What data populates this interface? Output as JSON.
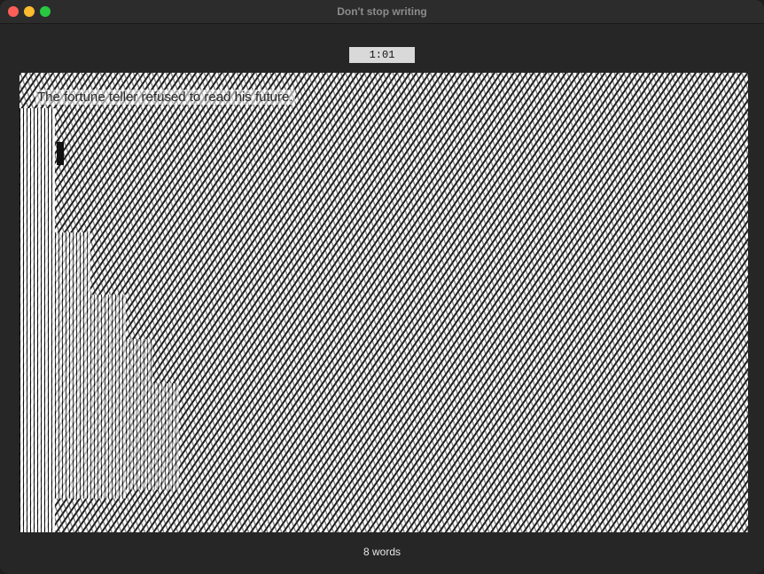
{
  "window": {
    "title": "Don't stop writing"
  },
  "timer": {
    "value": "1:01"
  },
  "editor": {
    "text": "The fortune teller refused to read his future."
  },
  "footer": {
    "word_count": "8 words"
  },
  "colors": {
    "close": "#ff5f57",
    "minimize": "#febc2e",
    "zoom": "#28c840",
    "window_bg": "#262626"
  }
}
